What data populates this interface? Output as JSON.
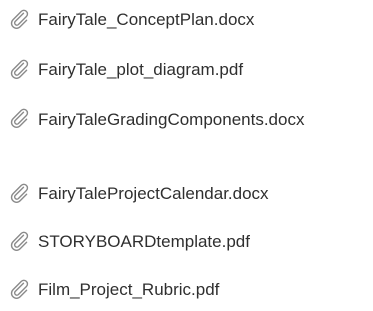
{
  "attachments": {
    "icon": "paperclip-icon",
    "items": [
      {
        "label": "FairyTale_ConceptPlan.docx"
      },
      {
        "label": "FairyTale_plot_diagram.pdf"
      },
      {
        "label": "FairyTaleGradingComponents.docx"
      },
      {
        "label": "FairyTaleProjectCalendar.docx"
      },
      {
        "label": "STORYBOARDtemplate.pdf"
      },
      {
        "label": "Film_Project_Rubric.pdf"
      }
    ]
  }
}
